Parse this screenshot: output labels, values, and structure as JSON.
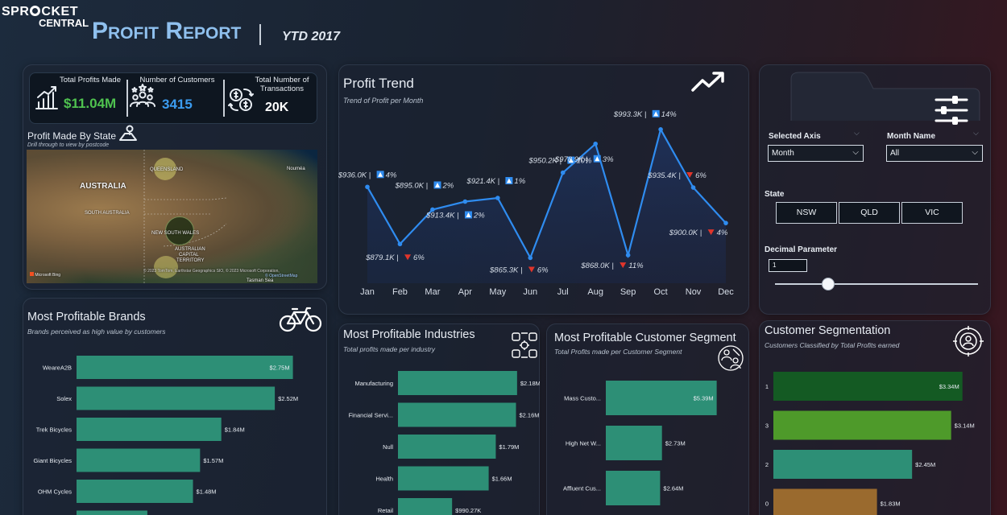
{
  "header": {
    "logo_top": "SPR",
    "logo_top_rest": "CKET",
    "logo_bottom": "CENTRAL",
    "title": "Profit Report",
    "period": "YTD 2017"
  },
  "kpis": [
    {
      "label": "Total Profits Made",
      "value": "$11.04M",
      "color": "#4fc24f",
      "icon": "money-growth-icon"
    },
    {
      "label": "Number of Customers",
      "value": "3415",
      "color": "#3b9cf0",
      "icon": "customers-icon"
    },
    {
      "label_line1": "Total Number of",
      "label_line2": "Transactions",
      "value": "20K",
      "color": "#ffffff",
      "icon": "transactions-icon"
    }
  ],
  "map_panel": {
    "title": "Profit Made By State",
    "subtitle": "Drill through to view by postcode",
    "labels": {
      "australia": "AUSTRALIA",
      "south_australia": "SOUTH AUSTRALIA",
      "queensland": "QUEENSLAND",
      "nsw": "NEW SOUTH WALES",
      "act_1": "AUSTRALIAN",
      "act_2": "CAPITAL",
      "act_3": "TERRITORY",
      "noumea": "Nouméa",
      "tasman": "Tasman Sea",
      "bing": "Microsoft Bing",
      "credits": "© 2023 TomTom, Earthstar Geographics SIO, © 2023 Microsoft Corporation,",
      "osm": "© OpenStreetMap"
    }
  },
  "trend_panel": {
    "title": "Profit Trend",
    "subtitle": "Trend of Profit per Month"
  },
  "chart_data": [
    {
      "type": "line",
      "title": "Profit Trend",
      "subtitle": "Trend of Profit per Month",
      "categories": [
        "Jan",
        "Feb",
        "Mar",
        "Apr",
        "May",
        "Jun",
        "Jul",
        "Aug",
        "Sep",
        "Oct",
        "Nov",
        "Dec"
      ],
      "values": [
        936.0,
        879.1,
        913.4,
        921.4,
        925.0,
        865.3,
        950.2,
        978.9,
        868.0,
        993.3,
        935.4,
        900.0
      ],
      "value_labels": [
        "$936.0K",
        "$879.1K",
        "$895.0K",
        "$913.4K",
        "$921.4K",
        "$865.3K",
        "$950.2K",
        "$978.9K",
        "$868.0K",
        "$993.3K",
        "$935.4K",
        "$900.0K"
      ],
      "change_labels": [
        {
          "text": "4%",
          "dir": "up"
        },
        {
          "text": "6%",
          "dir": "down"
        },
        {
          "text": "2%",
          "dir": "up"
        },
        {
          "text": "2%",
          "dir": "up"
        },
        {
          "text": "1%",
          "dir": "up"
        },
        {
          "text": "6%",
          "dir": "down"
        },
        {
          "text": "10%",
          "dir": "up"
        },
        {
          "text": "3%",
          "dir": "up"
        },
        {
          "text": "11%",
          "dir": "down"
        },
        {
          "text": "14%",
          "dir": "up"
        },
        {
          "text": "6%",
          "dir": "down"
        },
        {
          "text": "4%",
          "dir": "down"
        }
      ],
      "ylim": [
        840,
        1010
      ],
      "colors": {
        "line": "#2f8cf0",
        "up": "#2f8cf0",
        "down": "#e0352b"
      }
    },
    {
      "type": "bar",
      "title": "Most Profitable Brands",
      "subtitle": "Brands perceived as high value by customers",
      "categories": [
        "WeareA2B",
        "Solex",
        "Trek Bicycles",
        "Giant Bicycles",
        "OHM Cycles",
        ""
      ],
      "values": [
        2.75,
        2.52,
        1.84,
        1.57,
        1.48,
        0.9
      ],
      "value_labels": [
        "$2.75M",
        "$2.52M",
        "$1.84M",
        "$1.57M",
        "$1.48M",
        ""
      ],
      "xlim": [
        0,
        3.0
      ],
      "color": "#2d8f76"
    },
    {
      "type": "bar",
      "title": "Most Profitable Industries",
      "subtitle": "Total profits made per industry",
      "categories": [
        "Manufacturing",
        "Financial Servi...",
        "Null",
        "Health",
        "Retail"
      ],
      "values": [
        2.18,
        2.16,
        1.79,
        1.66,
        0.99027
      ],
      "value_labels": [
        "$2.18M",
        "$2.16M",
        "$1.79M",
        "$1.66M",
        "$990.27K"
      ],
      "xlim": [
        0,
        2.3
      ],
      "color": "#2d8f76"
    },
    {
      "type": "bar",
      "title": "Most Profitable Customer Segment",
      "subtitle": "Total Profits made per Customer Segment",
      "categories": [
        "Mass Custo...",
        "High Net W...",
        "Affluent Cus..."
      ],
      "values": [
        5.39,
        2.73,
        2.64
      ],
      "value_labels": [
        "$5.39M",
        "$2.73M",
        "$2.64M"
      ],
      "xlim": [
        0,
        5.6
      ],
      "color": "#2d8f76"
    },
    {
      "type": "bar",
      "title": "Customer Segmentation",
      "subtitle": "Customers Classified by Total Profits earned",
      "categories": [
        "1",
        "3",
        "2",
        "0"
      ],
      "values": [
        3.34,
        3.14,
        2.45,
        1.83
      ],
      "value_labels": [
        "$3.34M",
        "$3.14M",
        "$2.45M",
        "$1.83M"
      ],
      "xlim": [
        0,
        3.6
      ],
      "colors": [
        "#145a23",
        "#4e9a2a",
        "#2d8f76",
        "#9a6a2e"
      ]
    }
  ],
  "filters": {
    "selected_axis_label": "Selected Axis",
    "selected_axis_value": "Month",
    "month_name_label": "Month Name",
    "month_name_value": "All",
    "state_label": "State",
    "states": [
      "NSW",
      "QLD",
      "VIC"
    ],
    "decimal_label": "Decimal Parameter",
    "decimal_value": "1",
    "slider_fraction": 0.26
  },
  "panels": {
    "brands_title": "Most Profitable Brands",
    "brands_sub": "Brands perceived as high value by customers",
    "industries_title": "Most Profitable Industries",
    "industries_sub": "Total profits made per industry",
    "segment_title": "Most Profitable Customer Segment",
    "segment_sub": "Total Profits made per Customer Segment",
    "custseg_title": "Customer Segmentation",
    "custseg_sub": "Customers Classified by Total Profits earned"
  }
}
